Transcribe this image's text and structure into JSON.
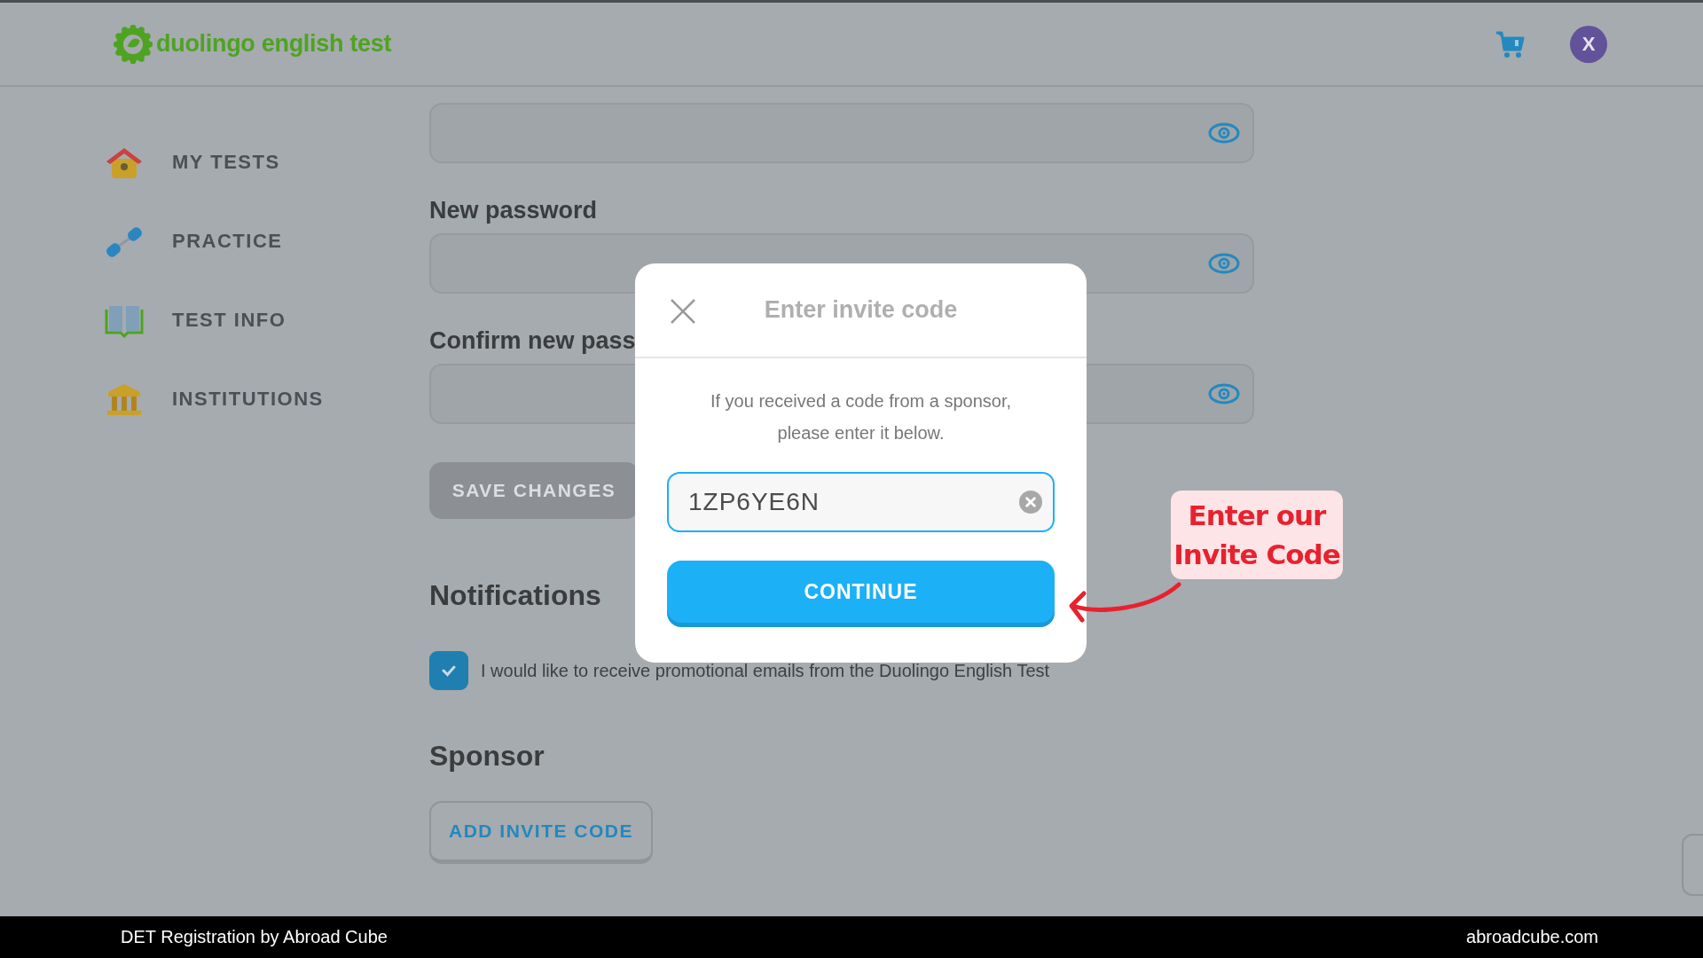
{
  "header": {
    "logo_text": "duolingo english test",
    "avatar_initial": "X"
  },
  "sidebar": {
    "items": [
      {
        "kind": "house",
        "label": "MY TESTS"
      },
      {
        "kind": "dumbbell",
        "label": "PRACTICE"
      },
      {
        "kind": "book",
        "label": "TEST INFO"
      },
      {
        "kind": "building",
        "label": "INSTITUTIONS"
      }
    ]
  },
  "password_fields": [
    {
      "label": "New password"
    },
    {
      "label": "Confirm new pass"
    }
  ],
  "save_button": {
    "label": "SAVE CHANGES",
    "disabled": true
  },
  "notifications": {
    "heading": "Notifications",
    "checkbox": {
      "label": "I would like to receive promotional emails from the Duolingo English Test",
      "checked": true
    }
  },
  "sponsor": {
    "heading": "Sponsor",
    "button": "ADD INVITE CODE"
  },
  "modal": {
    "title": "Enter invite code",
    "message": "If you received a code from a sponsor,\nplease enter it below.",
    "code": "1ZP6YE6N",
    "button": "CONTINUE"
  },
  "annotation": {
    "text": "Enter our\nInvite Code"
  },
  "footer": {
    "left": "DET Registration by Abroad Cube",
    "right": "abroadcube.com"
  }
}
